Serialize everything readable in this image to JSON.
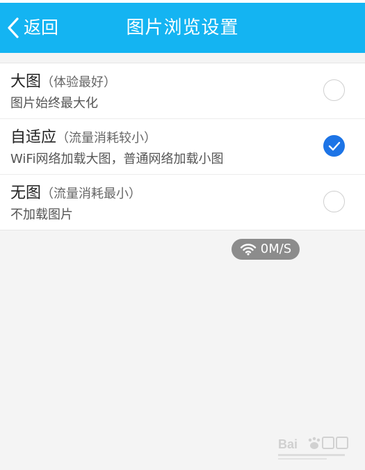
{
  "header": {
    "back_label": "返回",
    "title": "图片浏览设置",
    "background": "#14b4f2"
  },
  "options": [
    {
      "name": "大图",
      "note": "（体验最好）",
      "description": "图片始终最大化",
      "selected": false
    },
    {
      "name": "自适应",
      "note": "（流量消耗较小）",
      "description": "WiFi网络加载大图，普通网络加载小图",
      "selected": true
    },
    {
      "name": "无图",
      "note": "（流量消耗最小）",
      "description": "不加载图片",
      "selected": false
    }
  ],
  "speed_indicator": {
    "icon": "wifi-icon",
    "value": "0M/S"
  },
  "colors": {
    "accent": "#1d74e6",
    "page_background": "#f4f4f4"
  }
}
